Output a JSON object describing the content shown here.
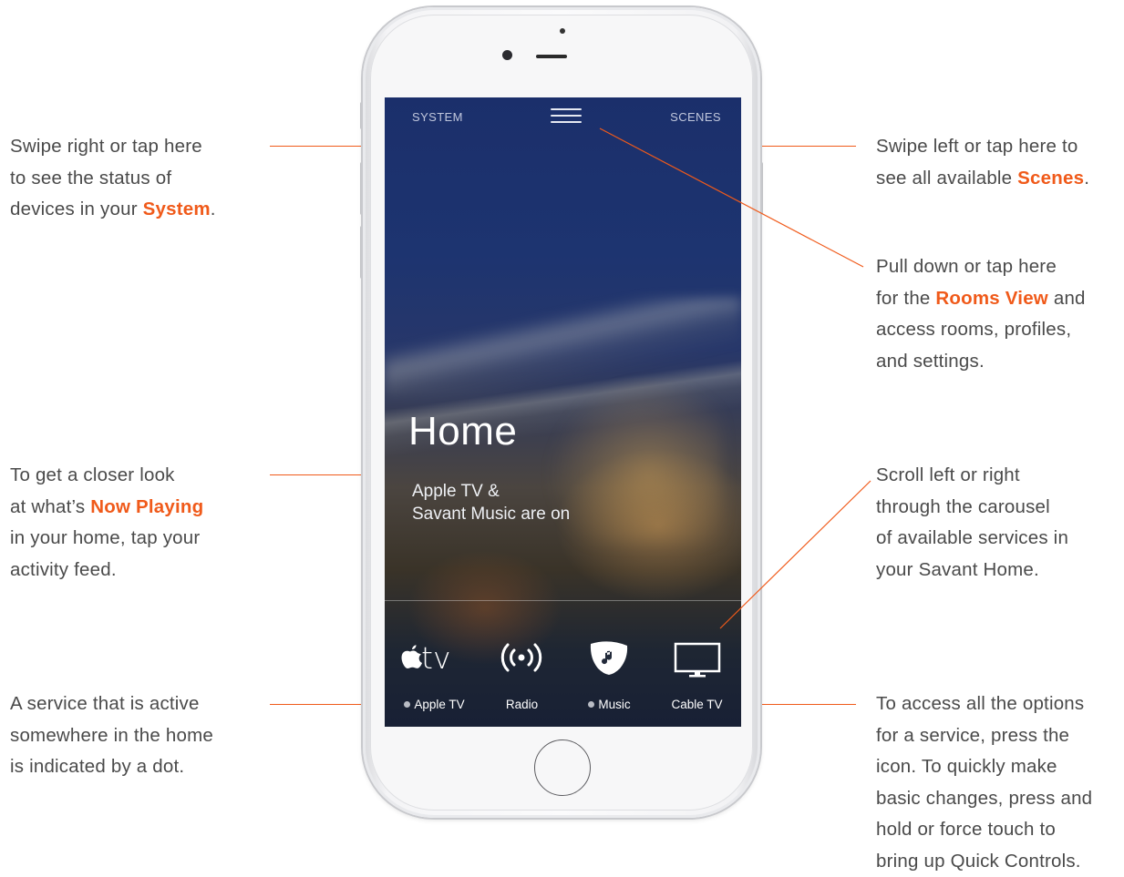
{
  "screen": {
    "system_label": "SYSTEM",
    "scenes_label": "SCENES",
    "room_title": "Home",
    "activity_line1": "Apple TV &",
    "activity_line2": "Savant Music are on",
    "services": [
      {
        "label": "Apple TV",
        "active": true,
        "icon": "apple-tv-icon"
      },
      {
        "label": "Radio",
        "active": false,
        "icon": "radio-icon"
      },
      {
        "label": "Music",
        "active": true,
        "icon": "music-icon"
      },
      {
        "label": "Cable TV",
        "active": false,
        "icon": "tv-icon"
      }
    ],
    "apple_tv_logo_text": "tv"
  },
  "callouts": {
    "system": {
      "line1": "Swipe right or tap here",
      "line2": "to see the status of",
      "line3_pre": "devices in your ",
      "highlight": "System",
      "line3_post": "."
    },
    "scenes": {
      "line1": "Swipe left or tap here to",
      "line2_pre": "see all available ",
      "highlight": "Scenes",
      "line2_post": "."
    },
    "rooms": {
      "line1": "Pull down or tap here",
      "line2_pre": "for the ",
      "highlight": "Rooms View",
      "line2_post": " and",
      "line3": "access rooms, profiles,",
      "line4": "and settings."
    },
    "now_playing": {
      "line1": "To get a closer look",
      "line2_pre": "at what’s ",
      "highlight": "Now Playing",
      "line3": "in your home, tap your",
      "line4": "activity feed."
    },
    "carousel": {
      "line1": "Scroll left or right",
      "line2": "through the carousel",
      "line3": "of available services in",
      "line4": "your Savant Home."
    },
    "active_dot": {
      "line1": "A service that is active",
      "line2": "somewhere in the home",
      "line3": "is indicated by a dot."
    },
    "options": {
      "line1": "To access all the options",
      "line2": "for a service, press the",
      "line3": "icon. To quickly make",
      "line4": "basic changes, press and",
      "line5": "hold or force touch to",
      "line6": "bring up Quick Controls."
    }
  },
  "colors": {
    "accent": "#f05a1a",
    "body_text": "#4a4a4a"
  }
}
